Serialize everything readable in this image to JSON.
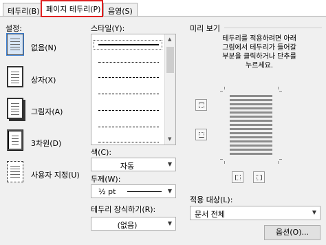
{
  "tabs": [
    {
      "label": "테두리(B)"
    },
    {
      "label": "페이지 테두리(P)"
    },
    {
      "label": "음영(S)"
    }
  ],
  "setting": {
    "heading": "설정:",
    "options": [
      {
        "label": "없음(N)"
      },
      {
        "label": "상자(X)"
      },
      {
        "label": "그림자(A)"
      },
      {
        "label": "3차원(D)"
      },
      {
        "label": "사용자 지정(U)"
      }
    ]
  },
  "style": {
    "heading": "스타일(Y):"
  },
  "color": {
    "label": "색(C):",
    "value": "자동"
  },
  "width": {
    "label": "두께(W):",
    "value": "½ pt"
  },
  "art": {
    "label": "테두리 장식하기(R):",
    "value": "(없음)"
  },
  "preview": {
    "heading": "미리 보기",
    "instructions": [
      "테두리를 적용하려면 아래",
      "그림에서 테두리가 들어갈",
      "부분을 클릭하거나 단추를",
      "누르세요."
    ]
  },
  "apply_to": {
    "label": "적용 대상(L):",
    "value": "문서 전체"
  },
  "options_button": {
    "label": "옵션(O)..."
  }
}
